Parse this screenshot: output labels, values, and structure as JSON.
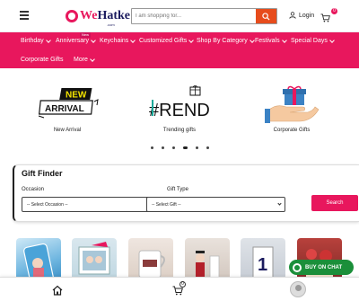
{
  "header": {
    "logo_we": "We",
    "logo_hatke": "Hatke",
    "logo_sub": ".com",
    "search_placeholder": "I am shopping for...",
    "login_label": "Login",
    "cart_count": "0"
  },
  "nav": {
    "items": [
      {
        "label": "Birthday"
      },
      {
        "label": "Anniversary"
      },
      {
        "label": "Keychains"
      },
      {
        "label": "Customized Gifts"
      },
      {
        "label": "Shop By Category"
      },
      {
        "label": "Festivals"
      },
      {
        "label": "Special Days"
      },
      {
        "label": "Corporate Gifts"
      },
      {
        "label": "More"
      }
    ],
    "new_badge": "New"
  },
  "banner": {
    "features": [
      {
        "caption": "New Arrival",
        "art_text_1": "NEW",
        "art_text_2": "ARRIVAL"
      },
      {
        "caption": "Trending gifts",
        "art_text": "#REND"
      },
      {
        "caption": "Corporate Gifts"
      }
    ],
    "slide_count": 6,
    "active_slide": 3
  },
  "gift_finder": {
    "title": "Gift Finder",
    "occasion_label": "Occasion",
    "occasion_value": "-- Select Occasion --",
    "gift_type_label": "Gift Type",
    "gift_type_value": "-- Select Gift --",
    "search_label": "Search"
  },
  "chat": {
    "label": "BUY ON CHAT"
  },
  "bottom_bar": {
    "cart_count": "0"
  },
  "colors": {
    "brand_pink": "#e8175d",
    "search_orange": "#e74c1c",
    "chat_green": "#1b8f3a"
  }
}
